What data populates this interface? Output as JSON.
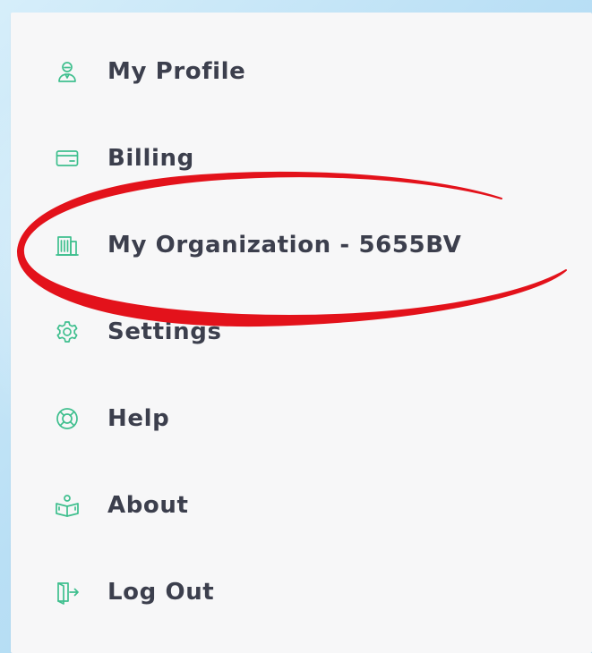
{
  "menu": {
    "items": [
      {
        "label": "My Profile",
        "icon": "user-profile-icon"
      },
      {
        "label": "Billing",
        "icon": "credit-card-icon"
      },
      {
        "label": "My Organization - 5655BV",
        "icon": "building-icon"
      },
      {
        "label": "Settings",
        "icon": "gear-icon"
      },
      {
        "label": "Help",
        "icon": "lifebuoy-icon"
      },
      {
        "label": "About",
        "icon": "book-reader-icon"
      },
      {
        "label": "Log Out",
        "icon": "logout-icon"
      }
    ]
  },
  "colors": {
    "accent": "#3fbf8e",
    "text": "#3c3f4d",
    "panel": "#f7f7f8",
    "annotation": "#e3121b"
  }
}
